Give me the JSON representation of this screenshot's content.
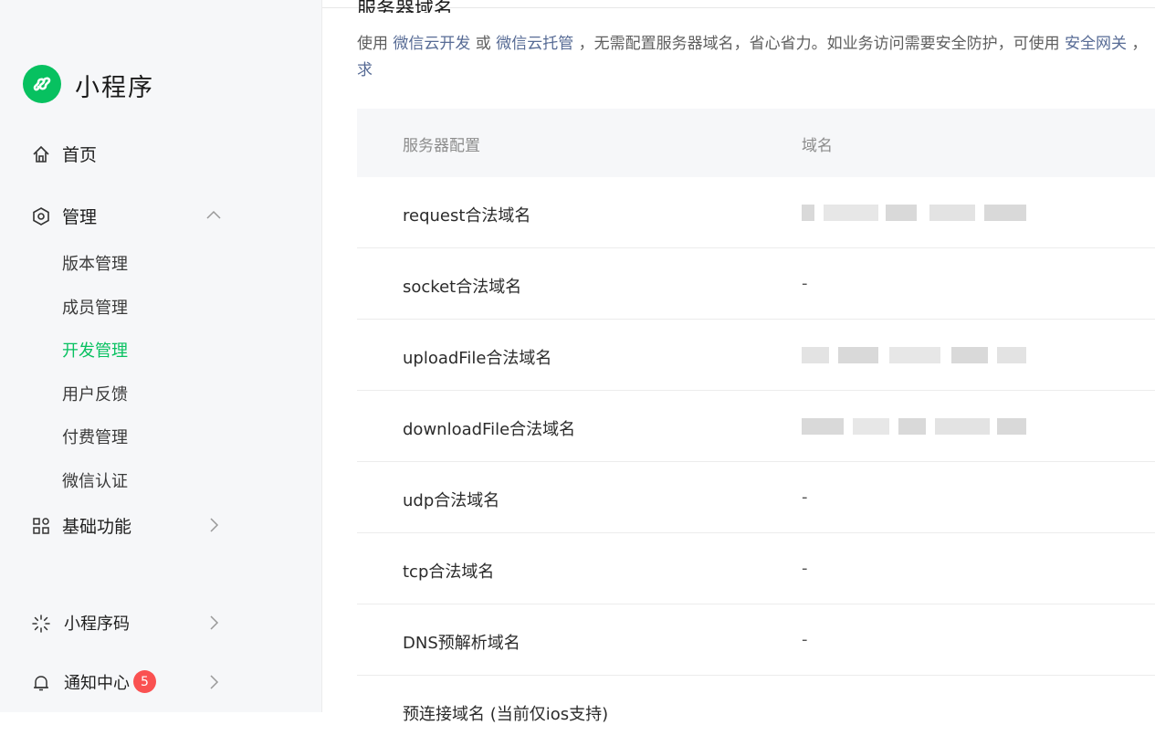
{
  "app": {
    "title": "小程序"
  },
  "nav": {
    "home": "首页",
    "manage": "管理",
    "manage_sub": [
      "版本管理",
      "成员管理",
      "开发管理",
      "用户反馈",
      "付费管理",
      "微信认证"
    ],
    "basic": "基础功能",
    "qrcode": "小程序码",
    "notice": "通知中心",
    "notice_badge": "5"
  },
  "content": {
    "section_title": "服务器域名",
    "desc": {
      "p1": "使用 ",
      "link1": "微信云开发",
      "p2": " 或 ",
      "link2": "微信云托管",
      "p3": " ，无需配置服务器域名，省心省力。如业务访问需要安全防护，可使用 ",
      "link3": "安全网关",
      "p4": " ，",
      "p5": "求"
    },
    "table": {
      "headers": [
        "服务器配置",
        "域名"
      ],
      "rows": [
        {
          "name": "request合法域名",
          "value": ""
        },
        {
          "name": "socket合法域名",
          "value": "-"
        },
        {
          "name": "uploadFile合法域名",
          "value": ""
        },
        {
          "name": "downloadFile合法域名",
          "value": ""
        },
        {
          "name": "udp合法域名",
          "value": "-"
        },
        {
          "name": "tcp合法域名",
          "value": "-"
        },
        {
          "name": "DNS预解析域名",
          "value": "-"
        },
        {
          "name": "预连接域名 (当前仅ios支持)",
          "value": ""
        }
      ]
    }
  },
  "colors": {
    "accent": "#07c160",
    "link": "#576b95",
    "badge": "#fa5151"
  }
}
